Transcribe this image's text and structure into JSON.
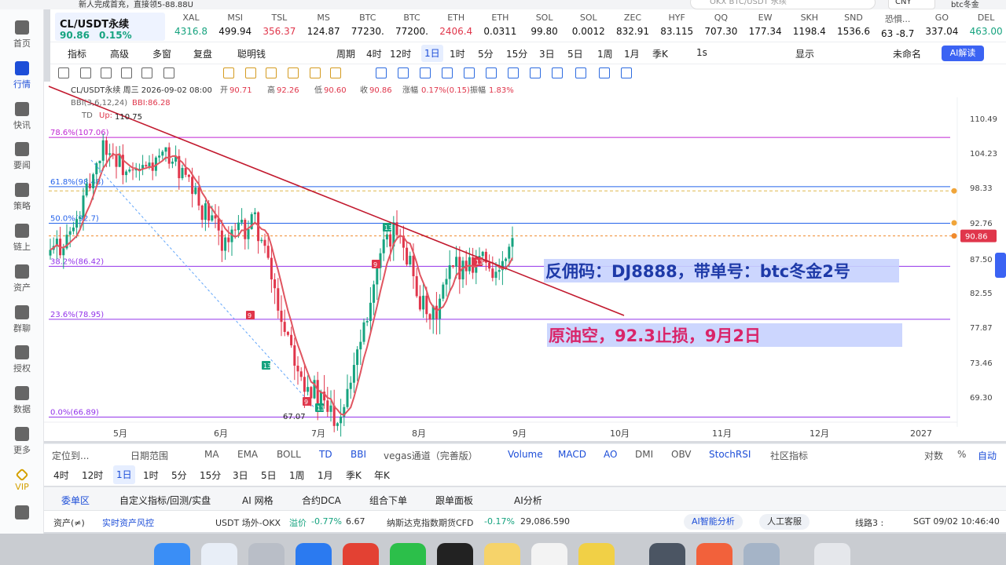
{
  "topstrip": {
    "notice": "新人完成首充，直接领5-88.88U",
    "search_placeholder": "OKX BTC/USDT 永续",
    "currency": "CNY",
    "user": "btc冬金"
  },
  "sidebar": [
    {
      "label": "首页",
      "icon": "home-icon"
    },
    {
      "label": "行情",
      "icon": "chart-icon",
      "active": true
    },
    {
      "label": "快讯",
      "icon": "news-icon"
    },
    {
      "label": "要闻",
      "icon": "article-icon"
    },
    {
      "label": "策略",
      "icon": "robot-icon"
    },
    {
      "label": "链上",
      "icon": "chain-icon"
    },
    {
      "label": "资产",
      "icon": "wallet-icon"
    },
    {
      "label": "群聊",
      "icon": "chat-icon"
    },
    {
      "label": "授权",
      "icon": "auth-icon"
    },
    {
      "label": "数据",
      "icon": "data-icon"
    },
    {
      "label": "更多",
      "icon": "more-icon"
    },
    {
      "label": "VIP",
      "icon": "vip-icon"
    },
    {
      "label": "",
      "icon": "settings-icon"
    }
  ],
  "ticker_main": {
    "symbol": "CL/USDT永续",
    "price": "90.86",
    "change": "0.15%"
  },
  "tickers": [
    {
      "symbol": "XAL",
      "price": "4316.8",
      "dir": "up"
    },
    {
      "symbol": "MSI",
      "price": "499.94",
      "dir": "neu"
    },
    {
      "symbol": "TSL",
      "price": "356.37",
      "dir": "dn"
    },
    {
      "symbol": "MS",
      "price": "124.87",
      "dir": "neu"
    },
    {
      "symbol": "BTC",
      "price": "77230.",
      "dir": "neu"
    },
    {
      "symbol": "BTC",
      "price": "77200.",
      "dir": "neu"
    },
    {
      "symbol": "ETH",
      "price": "2406.4",
      "dir": "dn"
    },
    {
      "symbol": "ETH",
      "price": "0.0311",
      "dir": "neu"
    },
    {
      "symbol": "SOL",
      "price": "99.80",
      "dir": "neu"
    },
    {
      "symbol": "SOL",
      "price": "0.0012",
      "dir": "neu"
    },
    {
      "symbol": "ZEC",
      "price": "832.91",
      "dir": "neu"
    },
    {
      "symbol": "HYF",
      "price": "83.115",
      "dir": "neu"
    },
    {
      "symbol": "QQ",
      "price": "707.30",
      "dir": "neu"
    },
    {
      "symbol": "EW",
      "price": "177.34",
      "dir": "neu"
    },
    {
      "symbol": "SKH",
      "price": "1198.4",
      "dir": "neu"
    },
    {
      "symbol": "SND",
      "price": "1536.6",
      "dir": "neu"
    },
    {
      "symbol": "恐惧...",
      "price": "63 -8.7",
      "dir": "neu"
    },
    {
      "symbol": "GO",
      "price": "337.04",
      "dir": "neu"
    },
    {
      "symbol": "DEL",
      "price": "463.00",
      "dir": "up"
    }
  ],
  "toolbar1": {
    "items": [
      "指标",
      "高级",
      "多窗",
      "复盘",
      "聪明钱",
      "周期",
      "4时",
      "12时",
      "1日",
      "1时",
      "5分",
      "15分",
      "3日",
      "5日",
      "1周",
      "1月",
      "季K",
      "1s",
      "显示",
      "未命名"
    ],
    "selected": "1日",
    "ai_label": "AI解读"
  },
  "chart_header": {
    "title": "CL/USDT永续",
    "meta": "周三 2026-09-02 08:00",
    "open_label": "开",
    "open": "90.71",
    "high_label": "高",
    "high": "92.26",
    "low_label": "低",
    "low": "90.60",
    "close_label": "收",
    "close": "90.86",
    "chg_label": "涨幅",
    "chg": "0.17%(0.15)",
    "amp_label": "振幅",
    "amp": "1.83%",
    "bbi": "BBI(3,6,12,24)",
    "bbi_val": "BBI:86.28",
    "td": "TD",
    "td_up": "Up:",
    "high_marker": "110.75",
    "low_marker": "67.07"
  },
  "chart_data": {
    "type": "candlestick",
    "yaxis_ticks": [
      "110.49",
      "104.23",
      "98.33",
      "92.76",
      "87.50",
      "82.55",
      "77.87",
      "73.46",
      "69.30"
    ],
    "xaxis_ticks": [
      "5月",
      "6月",
      "7月",
      "8月",
      "9月",
      "10月",
      "11月",
      "12月",
      "2027"
    ],
    "current_price": "90.86",
    "fib_levels": [
      {
        "label": "78.6%(107.06)",
        "color": "#c026d3"
      },
      {
        "label": "61.8%(98.48)",
        "color": "#2563eb"
      },
      {
        "label": "50.0%(92.7)",
        "color": "#2563eb"
      },
      {
        "label": "38.2%(86.42)",
        "color": "#9333ea"
      },
      {
        "label": "23.6%(78.95)",
        "color": "#9333ea"
      },
      {
        "label": "0.0%(66.89)",
        "color": "#9333ea"
      }
    ],
    "annotations": [
      "反佣码：DJ8888，带单号：btc冬金2号",
      "原油空，92.3止损，9月2日"
    ],
    "td_counts": [
      "9",
      "13",
      "9",
      "13",
      "9",
      "13",
      "13"
    ],
    "colors": {
      "up": "#16a37f",
      "down": "#e0364b",
      "bbi": "#e05560",
      "trend": "#c2192e"
    }
  },
  "bottombar1": {
    "locate": "定位到...",
    "range": "日期范围",
    "indicators": [
      "MA",
      "EMA",
      "BOLL",
      "TD",
      "BBI",
      "vegas通道（完善版）",
      "Volume",
      "MACD",
      "AO",
      "DMI",
      "OBV",
      "StochRSI"
    ],
    "community": "社区指标",
    "right": [
      "对数",
      "%",
      "自动"
    ]
  },
  "bottombar2": {
    "periods": [
      "4时",
      "12时",
      "1日",
      "1时",
      "5分",
      "15分",
      "3日",
      "5日",
      "1周",
      "1月",
      "季K",
      "年K"
    ],
    "selected": "1日"
  },
  "tabs": [
    "委单区",
    "自定义指标/回测/实盘",
    "AI 网格",
    "合约DCA",
    "组合下单",
    "跟单面板",
    "AI分析"
  ],
  "statusbar": {
    "assets": "资产(≠)",
    "risk": "实时资产风控",
    "usdt_label": "USDT 场外-OKX",
    "premium_label": "溢价",
    "premium": "-0.77%",
    "usdt_price": "6.67",
    "nasdaq_label": "纳斯达克指数期货CFD",
    "nasdaq_chg": "-0.17%",
    "nasdaq_val": "29,086.590",
    "ai_analysis": "AI智能分析",
    "support": "人工客服",
    "line": "线路3 :",
    "time": "SGT 09/02 10:46:40"
  }
}
